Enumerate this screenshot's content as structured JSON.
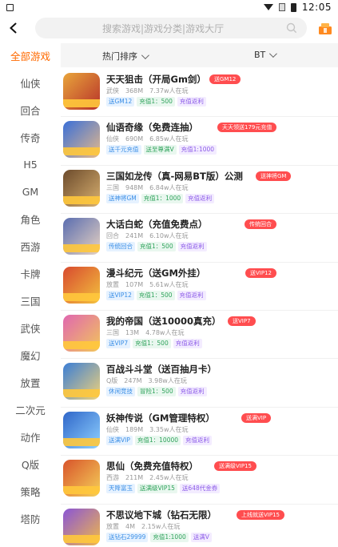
{
  "statusbar": {
    "time": "12:05"
  },
  "header": {
    "search_placeholder": "搜索游戏|游戏分类|游戏大厅"
  },
  "sidebar": {
    "categories": [
      "全部游戏",
      "仙侠",
      "回合",
      "传奇",
      "H5",
      "GM",
      "角色",
      "西游",
      "卡牌",
      "三国",
      "武侠",
      "魔幻",
      "放置",
      "二次元",
      "动作",
      "Q版",
      "策略",
      "塔防"
    ]
  },
  "filters": {
    "sort": "热门排序",
    "type": "BT"
  },
  "games": [
    {
      "title": "天天狙击（开局Gm剑）",
      "badge": "送GM12",
      "meta": [
        "武侠",
        "368M",
        "7.37w人在玩"
      ],
      "tags": [
        "送GM12",
        "充值1：500",
        "充值返利"
      ],
      "colors": [
        "#e9a53b",
        "#b7322a"
      ]
    },
    {
      "title": "仙语奇缘（免费连抽）",
      "badge": "天天领送179元充值",
      "meta": [
        "仙侠",
        "690M",
        "6.85w人在玩"
      ],
      "tags": [
        "送千元充值",
        "送至尊满V",
        "充值1:1000"
      ],
      "colors": [
        "#3a6fd8",
        "#e6b98a"
      ]
    },
    {
      "title": "三国如龙传（真-网易BT版）公测",
      "badge": "送神将GM",
      "meta": [
        "三国",
        "948M",
        "6.84w人在玩"
      ],
      "tags": [
        "送神将GM",
        "充值1：1000",
        "充值返利"
      ],
      "colors": [
        "#6c4b2c",
        "#d8b070"
      ]
    },
    {
      "title": "大话白蛇（充值免费点）",
      "badge": "传统回合",
      "meta": [
        "回合",
        "241M",
        "6.10w人在玩"
      ],
      "tags": [
        "传统回合",
        "充值1：500",
        "充值返利"
      ],
      "colors": [
        "#5a6db0",
        "#e7d2c2"
      ]
    },
    {
      "title": "漫斗纪元（送GM外挂）",
      "badge": "送VIP12",
      "meta": [
        "放置",
        "107M",
        "5.61w人在玩"
      ],
      "tags": [
        "送VIP12",
        "充值1：500",
        "充值返利"
      ],
      "colors": [
        "#d84a2f",
        "#f3c23e"
      ]
    },
    {
      "title": "我的帝国（送10000真充）",
      "badge": "送VIP7",
      "meta": [
        "三国",
        "13M",
        "4.78w人在玩"
      ],
      "tags": [
        "送VIP7",
        "充值1：500",
        "充值返利"
      ],
      "colors": [
        "#e067b0",
        "#f2c65a"
      ]
    },
    {
      "title": "百战斗斗堂（送百抽月卡）",
      "badge": "",
      "meta": [
        "Q版",
        "247M",
        "3.98w人在玩"
      ],
      "tags": [
        "休闲竞技",
        "冒险1：500",
        "充值返利"
      ],
      "colors": [
        "#3b7ed6",
        "#f0d27a"
      ]
    },
    {
      "title": "妖神传说（GM管理特权）",
      "badge": "送满VIP",
      "meta": [
        "仙侠",
        "189M",
        "3.35w人在玩"
      ],
      "tags": [
        "送满VIP",
        "充值1：10000",
        "充值返利"
      ],
      "colors": [
        "#2f66c9",
        "#8fd1ff"
      ]
    },
    {
      "title": "思仙（免费充值特权）",
      "badge": "送满级VIP15",
      "meta": [
        "西游",
        "211M",
        "2.45w人在玩"
      ],
      "tags": [
        "天降富玉",
        "送满级VIP15",
        "送648代金券"
      ],
      "colors": [
        "#d8542b",
        "#f5d15a"
      ]
    },
    {
      "title": "不思议地下城（钻石无限）",
      "badge": "上线就送VIP15",
      "meta": [
        "放置",
        "4M",
        "2.15w人在玩"
      ],
      "tags": [
        "送钻石29999",
        "充值1:1000",
        "送满V"
      ],
      "colors": [
        "#8a55d6",
        "#f0b84a"
      ]
    }
  ],
  "colors": {
    "accent": "#ff6a00",
    "badge": "#ff4d4f"
  }
}
